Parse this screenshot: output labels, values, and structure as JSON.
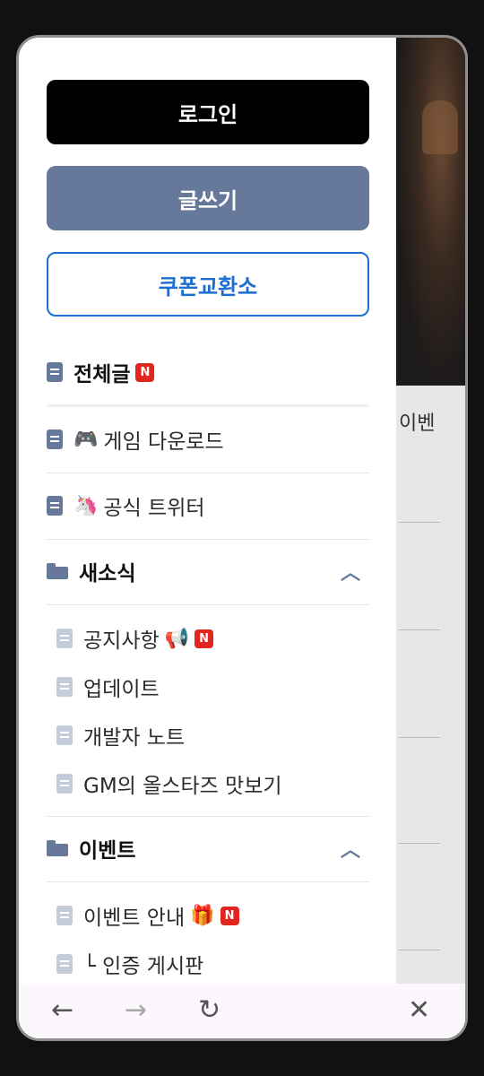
{
  "background": {
    "partial_text": "이벤"
  },
  "buttons": {
    "login": "로그인",
    "write": "글쓰기",
    "coupon": "쿠폰교환소"
  },
  "menu": {
    "all_posts": "전체글",
    "new_badge": "N",
    "game_download": {
      "emoji": "🎮",
      "label": "게임 다운로드"
    },
    "official_twitter": {
      "emoji": "🦄",
      "label": "공식 트위터"
    },
    "news": {
      "title": "새소식",
      "items": [
        {
          "label": "공지사항",
          "emoji": "📢"
        },
        {
          "label": "업데이트"
        },
        {
          "label": "개발자 노트"
        },
        {
          "label": "GM의 올스타즈 맛보기"
        }
      ]
    },
    "event": {
      "title": "이벤트",
      "items": [
        {
          "label": "이벤트 안내",
          "emoji": "🎁"
        },
        {
          "label": "└ 인증 게시판"
        }
      ]
    }
  },
  "navbar": {
    "back": "←",
    "forward": "→",
    "reload": "↻",
    "close": "✕"
  },
  "colors": {
    "accent": "#66799a",
    "coupon": "#1c6fd1",
    "new_badge": "#e0261f"
  }
}
